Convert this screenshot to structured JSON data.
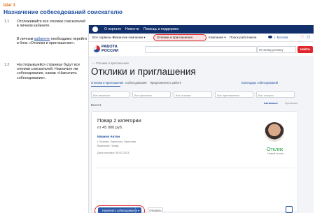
{
  "header": {
    "step": "Шаг 3",
    "title": "Назначение собеседований соискателю"
  },
  "instructions": [
    {
      "num": "1.1",
      "text": "Отслеживайте все отклики соискателей в личном кабинете."
    },
    {
      "num": "",
      "prefix": "В личном",
      "link": "кабинете",
      "suffix": "необходимо перейти в блок «Отклики и приглашения»."
    },
    {
      "num": "1.2",
      "text": "На открывшейся странице будут все отклики соискателей. Назначьте им собеседование, нажав «Назначить собеседование»."
    }
  ],
  "site": {
    "topnav": [
      "О портале",
      "Новости",
      "Помощь и поддержка"
    ],
    "menu": [
      "Все сервисы ▾",
      "Вакансии компании ▾",
      "Отклики и приглашения",
      "Компания ▾",
      "Поиск работников"
    ],
    "city": "г. Москва",
    "brand": "РАБОТА РОССИИ",
    "search_placeholder": "",
    "region": "По всему региону",
    "find_label": "Найти",
    "breadcrumb": "⌂ › Отклики и приглашения",
    "page_title": "Отклики и приглашения",
    "tabs": [
      "Отклики и приглашения",
      "Собеседования",
      "Предложения о работе"
    ],
    "calendar": "Календарь собеседований",
    "filters": [
      "Все вакансии",
      "Все филиалы",
      "Все отклики",
      "Все приглашения",
      "Все статусы"
    ],
    "total": "Всего 9",
    "segments": [
      "Активные",
      "Архивные"
    ],
    "card": {
      "job": "Повар 2 категории",
      "salary": "от 45 000 руб.",
      "name": "Иванов Антон",
      "lines": [
        "г. Москва, Заречная, Заречная",
        "Вакансия: Повар",
        "Дата отклика: 08.02.2023"
      ],
      "status": "Отклик",
      "status_sub": "Новый отклик",
      "primary_btn": "Назначить собеседование",
      "caret": "▾",
      "reject_btn": "Отказать"
    }
  },
  "colors": {
    "accent": "#e0262b",
    "brand": "#12306b",
    "link": "#1f4fa0",
    "success": "#2a9d4b",
    "step": "#e0701a"
  }
}
